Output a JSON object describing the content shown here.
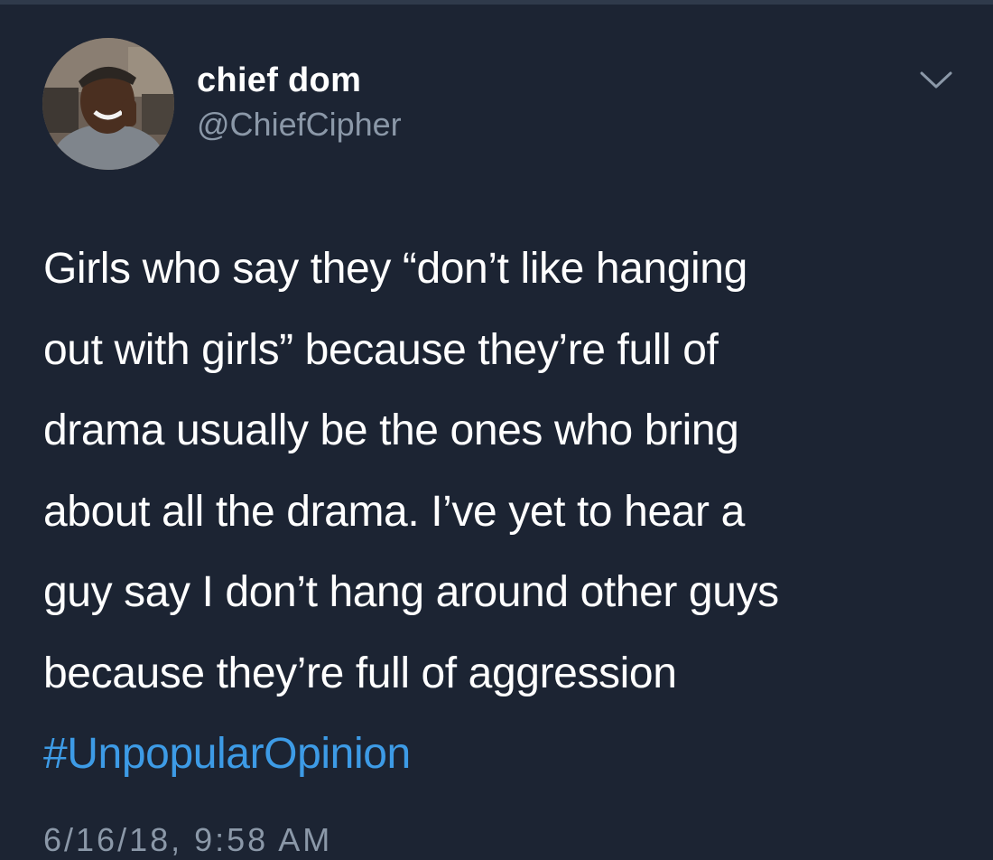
{
  "tweet": {
    "author": {
      "display_name": "chief dom",
      "handle": "@ChiefCipher",
      "avatar_icon": "profile-photo"
    },
    "menu_icon": "chevron-down-icon",
    "text_lines": [
      "Girls who say they “don’t like hanging",
      "out with girls” because they’re full of",
      "drama usually be the ones who bring",
      "about all the drama. I’ve yet to hear a",
      "guy say I don’t hang around other guys",
      "because they’re full of aggression"
    ],
    "hashtag": "#UnpopularOpinion",
    "timestamp": "6/16/18, 9:58 AM"
  },
  "colors": {
    "background": "#1c2433",
    "text": "#ffffff",
    "secondary_text": "#8b98a8",
    "link": "#3d9be6"
  }
}
